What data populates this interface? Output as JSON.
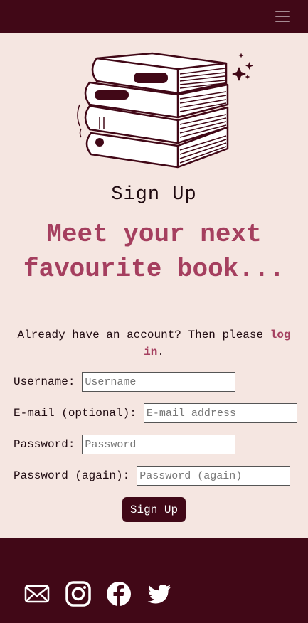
{
  "nav": {
    "menu_icon": "hamburger-menu-icon"
  },
  "hero": {
    "image_icon": "stacked-books-illustration"
  },
  "form": {
    "title": "Sign Up",
    "headline": "Meet your next favourite book...",
    "login_prompt": "Already have an account? Then please ",
    "login_link": "log in",
    "login_suffix": ".",
    "fields": [
      {
        "label": "Username:",
        "placeholder": "Username",
        "value": ""
      },
      {
        "label": "E-mail (optional):",
        "placeholder": "E-mail address",
        "value": ""
      },
      {
        "label": "Password:",
        "placeholder": "Password",
        "value": ""
      },
      {
        "label": "Password (again):",
        "placeholder": "Password (again)",
        "value": ""
      }
    ],
    "submit_label": "Sign Up"
  },
  "footer": {
    "social": [
      "email-icon",
      "instagram-icon",
      "facebook-icon",
      "twitter-icon"
    ]
  },
  "colors": {
    "brand": "#410817",
    "accent": "#a53f5f",
    "background": "#f5e6e1"
  }
}
